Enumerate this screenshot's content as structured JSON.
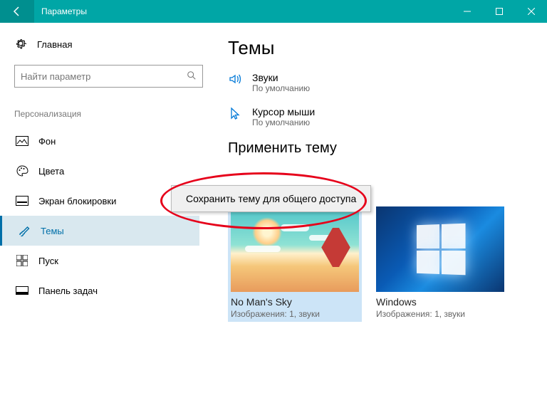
{
  "titlebar": {
    "title": "Параметры"
  },
  "sidebar": {
    "home": "Главная",
    "search_placeholder": "Найти параметр",
    "section": "Персонализация",
    "items": [
      {
        "key": "background",
        "label": "Фон"
      },
      {
        "key": "colors",
        "label": "Цвета"
      },
      {
        "key": "lockscreen",
        "label": "Экран блокировки"
      },
      {
        "key": "themes",
        "label": "Темы"
      },
      {
        "key": "start",
        "label": "Пуск"
      },
      {
        "key": "taskbar",
        "label": "Панель задач"
      }
    ]
  },
  "main": {
    "title": "Темы",
    "rows": [
      {
        "title": "Звуки",
        "sub": "По умолчанию"
      },
      {
        "title": "Курсор мыши",
        "sub": "По умолчанию"
      }
    ],
    "apply_heading": "Применить тему",
    "context_menu_item": "Сохранить тему для общего доступа",
    "themes": [
      {
        "name": "No Man's Sky",
        "sub": "Изображения: 1, звуки",
        "selected": true
      },
      {
        "name": "Windows",
        "sub": "Изображения: 1, звуки",
        "selected": false
      }
    ]
  }
}
